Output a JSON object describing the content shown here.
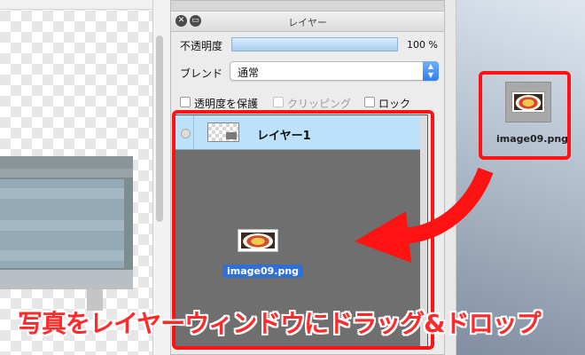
{
  "panel": {
    "title": "レイヤー",
    "opacity_label": "不透明度",
    "opacity_value": "100 %",
    "blend_label": "ブレンド",
    "blend_value": "通常",
    "options": {
      "preserve_transparency": "透明度を保護",
      "clipping": "クリッピング",
      "lock": "ロック"
    },
    "layers": [
      {
        "name": "レイヤー1",
        "selected": true
      }
    ]
  },
  "drag": {
    "file_label": "image09.png"
  },
  "desktop": {
    "file_label": "image09.png"
  },
  "caption": "写真をレイヤーウィンドウにドラッグ&ドロップ",
  "colors": {
    "annotation": "#ff1212",
    "selection": "#bde0fb",
    "drag_label_bg": "#2f6fd8"
  },
  "icons": [
    "close-icon",
    "minimize-icon",
    "chevron-updown-icon",
    "visibility-dot-icon"
  ]
}
